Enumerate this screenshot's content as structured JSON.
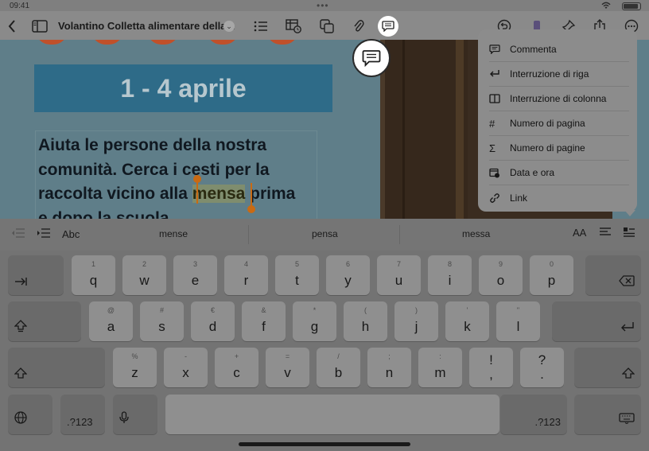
{
  "status": {
    "time": "09:41",
    "dots": "•••"
  },
  "toolbar": {
    "doc_title": "Volantino Colletta alimentare della..."
  },
  "document": {
    "date_banner": "1 - 4 aprile",
    "body_line1": "Aiuta le persone della nostra",
    "body_line2": "comunità. Cerca i cesti per la",
    "body_line3_pre": "raccolta vicino alla ",
    "body_line3_sel": "mensa",
    "body_line3_post": " prima",
    "body_line4": "e dopo la scuola."
  },
  "menu": {
    "items": [
      {
        "label": "Commenta",
        "icon": "comment-icon"
      },
      {
        "label": "Interruzione di riga",
        "icon": "line-break-icon"
      },
      {
        "label": "Interruzione di colonna",
        "icon": "column-break-icon"
      },
      {
        "label": "Numero di pagina",
        "icon": "hash-icon"
      },
      {
        "label": "Numero di pagine",
        "icon": "sigma-icon"
      },
      {
        "label": "Data e ora",
        "icon": "calendar-clock-icon"
      },
      {
        "label": "Link",
        "icon": "link-icon"
      }
    ]
  },
  "suggestions": {
    "abc": "Abc",
    "words": [
      "mense",
      "pensa",
      "messa"
    ],
    "aa": "AA"
  },
  "keyboard": {
    "row1": [
      {
        "alt": "1",
        "main": "q"
      },
      {
        "alt": "2",
        "main": "w"
      },
      {
        "alt": "3",
        "main": "e"
      },
      {
        "alt": "4",
        "main": "r"
      },
      {
        "alt": "5",
        "main": "t"
      },
      {
        "alt": "6",
        "main": "y"
      },
      {
        "alt": "7",
        "main": "u"
      },
      {
        "alt": "8",
        "main": "i"
      },
      {
        "alt": "9",
        "main": "o"
      },
      {
        "alt": "0",
        "main": "p"
      }
    ],
    "row2": [
      {
        "alt": "@",
        "main": "a"
      },
      {
        "alt": "#",
        "main": "s"
      },
      {
        "alt": "€",
        "main": "d"
      },
      {
        "alt": "&",
        "main": "f"
      },
      {
        "alt": "*",
        "main": "g"
      },
      {
        "alt": "(",
        "main": "h"
      },
      {
        "alt": ")",
        "main": "j"
      },
      {
        "alt": "'",
        "main": "k"
      },
      {
        "alt": "\"",
        "main": "l"
      }
    ],
    "row3": [
      {
        "alt": "%",
        "main": "z"
      },
      {
        "alt": "-",
        "main": "x"
      },
      {
        "alt": "+",
        "main": "c"
      },
      {
        "alt": "=",
        "main": "v"
      },
      {
        "alt": "/",
        "main": "b"
      },
      {
        "alt": ";",
        "main": "n"
      },
      {
        "alt": ":",
        "main": "m"
      },
      {
        "alt": "",
        "main": "!"
      },
      {
        "alt": "",
        "main": "?"
      }
    ],
    "row3_extra": {
      "exclam_sub": ",",
      "question_sub": "."
    },
    "numbers_label": ".?123"
  }
}
